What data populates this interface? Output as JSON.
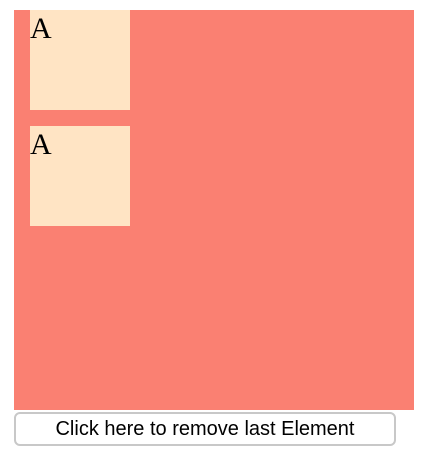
{
  "container": {
    "background_color": "#FA8072"
  },
  "boxes": [
    {
      "label": "A",
      "color": "#FFE4C4"
    },
    {
      "label": "A",
      "color": "#FFE4C4"
    }
  ],
  "button": {
    "label": "Click here to remove last Element"
  }
}
